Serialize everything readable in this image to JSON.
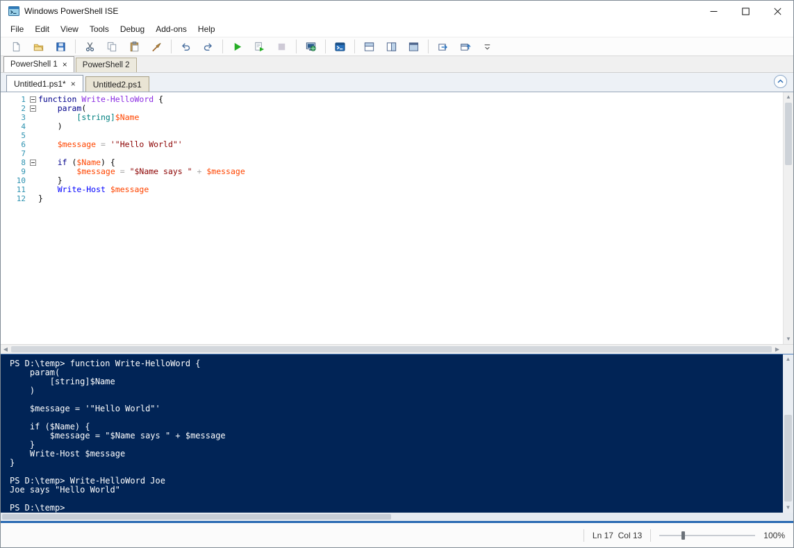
{
  "window": {
    "title": "Windows PowerShell ISE"
  },
  "menu": [
    "File",
    "Edit",
    "View",
    "Tools",
    "Debug",
    "Add-ons",
    "Help"
  ],
  "toolbar": [
    {
      "id": "new-script",
      "title": "New Script"
    },
    {
      "id": "open-script",
      "title": "Open Script"
    },
    {
      "id": "save-script",
      "title": "Save Script"
    },
    {
      "sep": true
    },
    {
      "id": "cut",
      "title": "Cut"
    },
    {
      "id": "copy",
      "title": "Copy"
    },
    {
      "id": "paste",
      "title": "Paste"
    },
    {
      "id": "clear-console",
      "title": "Clear Console Pane"
    },
    {
      "sep": true
    },
    {
      "id": "undo",
      "title": "Undo"
    },
    {
      "id": "redo",
      "title": "Redo"
    },
    {
      "sep": true
    },
    {
      "id": "run-script",
      "title": "Run Script"
    },
    {
      "id": "run-selection",
      "title": "Run Selection"
    },
    {
      "id": "stop-operation",
      "title": "Stop Operation",
      "disabled": true
    },
    {
      "sep": true
    },
    {
      "id": "new-remote-powershell-tab",
      "title": "New Remote PowerShell Tab"
    },
    {
      "sep": true
    },
    {
      "id": "start-powershell",
      "title": "Start PowerShell.exe"
    },
    {
      "sep": true
    },
    {
      "id": "script-pane-top",
      "title": "Show Script Pane Top"
    },
    {
      "id": "script-pane-right",
      "title": "Show Script Pane Right"
    },
    {
      "id": "script-pane-max",
      "title": "Show Script Pane Maximized"
    },
    {
      "sep": true
    },
    {
      "id": "show-command-window",
      "title": "Show Command Window"
    },
    {
      "id": "show-script-pane",
      "title": "Show Script Pane"
    },
    {
      "id": "toolbar-overflow",
      "title": "Toolbar Options"
    }
  ],
  "powershell_tabs": [
    {
      "label": "PowerShell 1",
      "active": true,
      "closable": true
    },
    {
      "label": "PowerShell 2",
      "active": false,
      "closable": false
    }
  ],
  "script_tabs": [
    {
      "label": "Untitled1.ps1*",
      "active": true,
      "closable": true
    },
    {
      "label": "Untitled2.ps1",
      "active": false,
      "closable": false
    }
  ],
  "editor": {
    "lines": [
      {
        "n": 1,
        "fold": true,
        "tokens": [
          [
            "kw",
            "function"
          ],
          [
            "pl",
            " "
          ],
          [
            "arg",
            "Write-HelloWord"
          ],
          [
            "pl",
            " {"
          ]
        ]
      },
      {
        "n": 2,
        "fold": true,
        "tokens": [
          [
            "pl",
            "    "
          ],
          [
            "kw",
            "param"
          ],
          [
            "pl",
            "("
          ]
        ]
      },
      {
        "n": 3,
        "fold": false,
        "tokens": [
          [
            "pl",
            "        "
          ],
          [
            "type",
            "[string]"
          ],
          [
            "var",
            "$Name"
          ]
        ]
      },
      {
        "n": 4,
        "fold": false,
        "tokens": [
          [
            "pl",
            "    )"
          ]
        ]
      },
      {
        "n": 5,
        "fold": false,
        "tokens": []
      },
      {
        "n": 6,
        "fold": false,
        "tokens": [
          [
            "pl",
            "    "
          ],
          [
            "var",
            "$message"
          ],
          [
            "op",
            " = "
          ],
          [
            "str",
            "'\"Hello World\"'"
          ]
        ]
      },
      {
        "n": 7,
        "fold": false,
        "tokens": []
      },
      {
        "n": 8,
        "fold": true,
        "tokens": [
          [
            "pl",
            "    "
          ],
          [
            "kw",
            "if"
          ],
          [
            "pl",
            " ("
          ],
          [
            "var",
            "$Name"
          ],
          [
            "pl",
            ") {"
          ]
        ]
      },
      {
        "n": 9,
        "fold": false,
        "tokens": [
          [
            "pl",
            "        "
          ],
          [
            "var",
            "$message"
          ],
          [
            "op",
            " = "
          ],
          [
            "str",
            "\"$Name says \""
          ],
          [
            "op",
            " + "
          ],
          [
            "var",
            "$message"
          ]
        ]
      },
      {
        "n": 10,
        "fold": false,
        "tokens": [
          [
            "pl",
            "    }"
          ]
        ]
      },
      {
        "n": 11,
        "fold": false,
        "tokens": [
          [
            "pl",
            "    "
          ],
          [
            "cmd",
            "Write-Host"
          ],
          [
            "pl",
            " "
          ],
          [
            "var",
            "$message"
          ]
        ]
      },
      {
        "n": 12,
        "fold": false,
        "tokens": [
          [
            "pl",
            "}"
          ]
        ]
      }
    ]
  },
  "console": {
    "lines": [
      "PS D:\\temp> function Write-HelloWord {",
      "    param(",
      "        [string]$Name",
      "    )",
      "",
      "    $message = '\"Hello World\"'",
      "",
      "    if ($Name) {",
      "        $message = \"$Name says \" + $message",
      "    }",
      "    Write-Host $message",
      "}",
      "",
      "PS D:\\temp> Write-HelloWord Joe",
      "Joe says \"Hello World\"",
      "",
      "PS D:\\temp>"
    ]
  },
  "status": {
    "cursor_position": "Ln 17  Col 13",
    "zoom": "100%"
  },
  "colors": {
    "keyword": "#00008B",
    "command": "#0000FF",
    "variable": "#FF4500",
    "string": "#8B0000",
    "type": "#008080",
    "operator": "#A9A9A9",
    "command_argument": "#8A2BE2",
    "console_bg": "#012456",
    "status_accent": "#2668b2"
  }
}
